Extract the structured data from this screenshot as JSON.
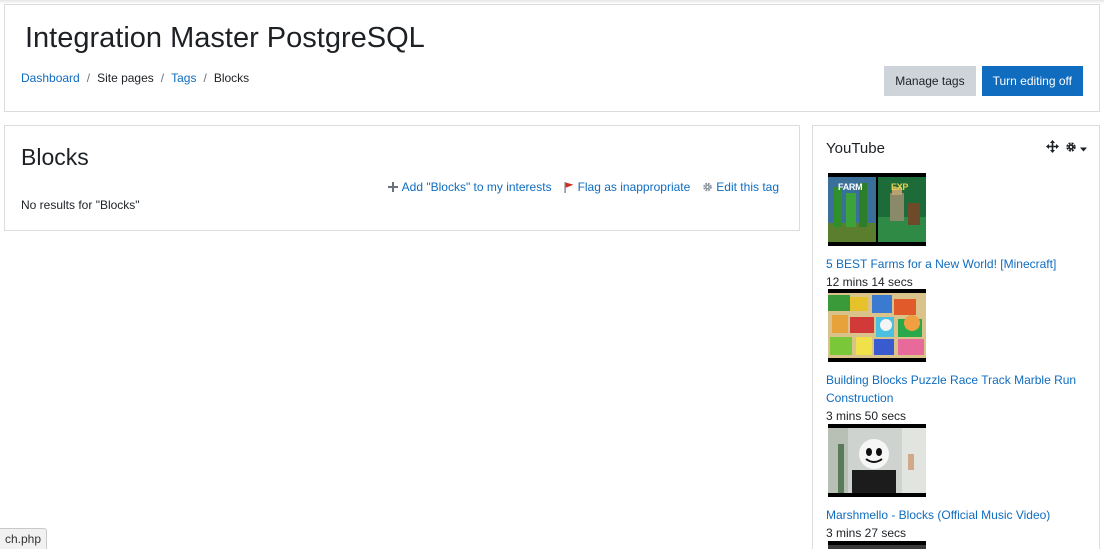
{
  "header": {
    "title": "Integration Master PostgreSQL",
    "breadcrumb": [
      "Dashboard",
      "Site pages",
      "Tags",
      "Blocks"
    ],
    "manage_tags_label": "Manage tags",
    "turn_editing_label": "Turn editing off"
  },
  "main": {
    "title": "Blocks",
    "actions": {
      "add_interests": "Add \"Blocks\" to my interests",
      "flag": "Flag as inappropriate",
      "edit_tag": "Edit this tag"
    },
    "no_results": "No results for \"Blocks\""
  },
  "youtube": {
    "title": "YouTube",
    "videos": [
      {
        "title": "5 BEST Farms for a New World! [Minecraft]",
        "duration": "12 mins 14 secs",
        "thumb_text_left": "FARM",
        "thumb_text_right": "EXP"
      },
      {
        "title": "Building Blocks Puzzle Race Track Marble Run Construction",
        "duration": "3 mins 50 secs"
      },
      {
        "title": "Marshmello - Blocks (Official Music Video)",
        "duration": "3 mins 27 secs"
      }
    ]
  },
  "statusbar": {
    "text": "ch.php"
  },
  "colors": {
    "link": "#0f6cbf",
    "primary": "#0f6cbf",
    "secondary": "#ced4da",
    "flag": "#ca3120",
    "border": "#dcdcdc"
  }
}
